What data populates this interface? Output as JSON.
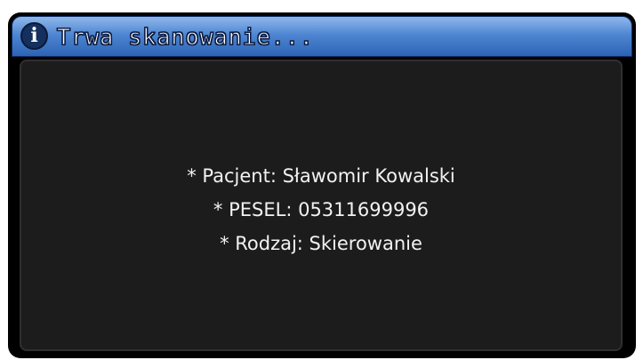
{
  "dialog": {
    "title": "Trwa skanowanie...",
    "icon": "info-icon",
    "icon_glyph": "i",
    "lines": [
      "* Pacjent: Sławomir Kowalski",
      "* PESEL: 05311699996",
      "* Rodzaj: Skierowanie"
    ]
  },
  "colors": {
    "titlebar": "#4e86d2",
    "background": "#1c1c1c",
    "text": "#f2f2f2"
  }
}
